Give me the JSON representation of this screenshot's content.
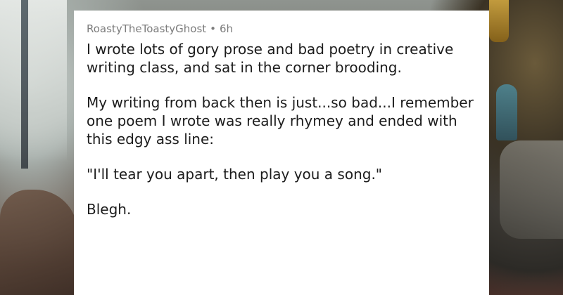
{
  "comment": {
    "author": "RoastyTheToastyGhost",
    "separator": "•",
    "age": "6h",
    "paragraphs": [
      "I wrote lots of gory prose and bad poetry in creative writing class, and sat in the corner brooding.",
      "My writing from back then is just...so bad...I remember one poem I wrote was really rhymey and ended with this edgy ass line:",
      "\"I'll tear you apart, then play you a song.\"",
      "Blegh."
    ]
  }
}
